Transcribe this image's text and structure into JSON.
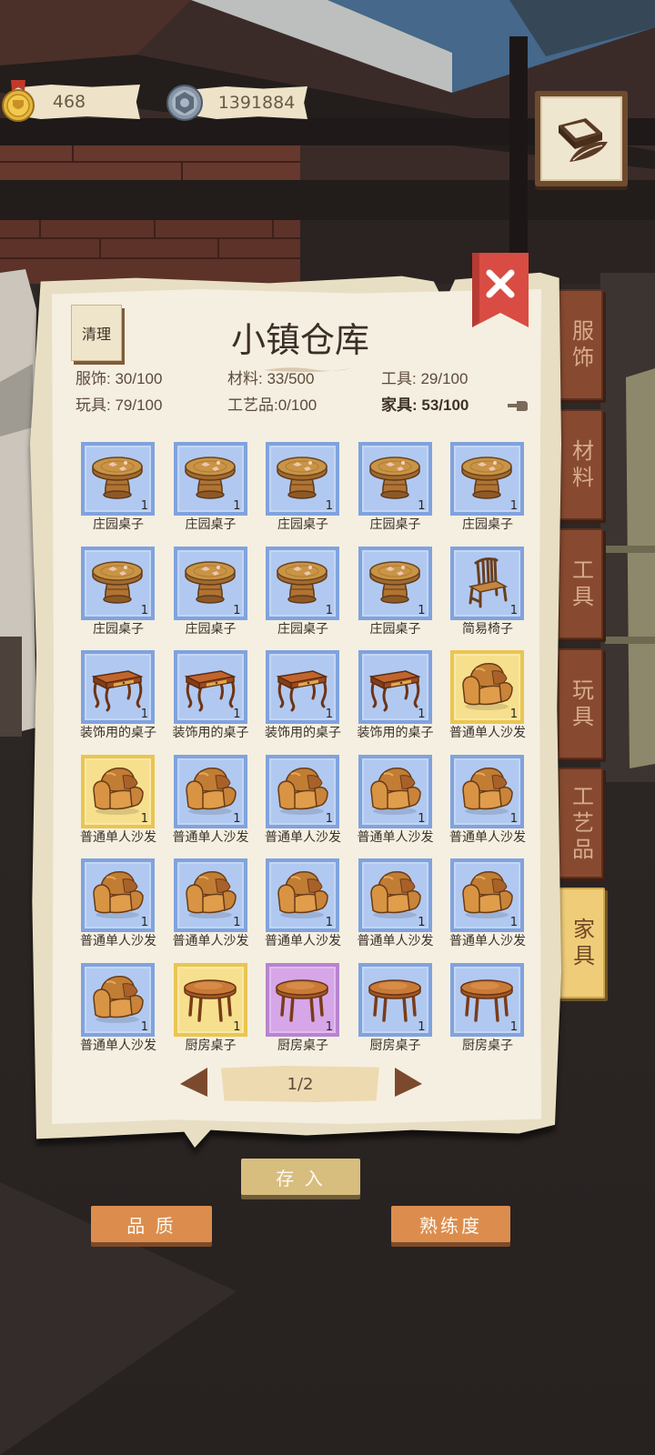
{
  "currency": {
    "gold": {
      "icon": "gold-coin-icon",
      "value": "468"
    },
    "gear": {
      "icon": "gear-coin-icon",
      "value": "1391884"
    }
  },
  "journal": {
    "icon": "journal-icon"
  },
  "warehouse": {
    "title": "小镇仓库",
    "clear_label": "清理",
    "close_icon": "close-icon",
    "stats": [
      {
        "text": "服饰: 30/100",
        "highlight": false
      },
      {
        "text": "材料: 33/500",
        "highlight": false
      },
      {
        "text": "工具: 29/100",
        "highlight": false
      },
      {
        "text": "玩具: 79/100",
        "highlight": false
      },
      {
        "text": "工艺品:0/100",
        "highlight": false
      },
      {
        "text": "家具: 53/100",
        "highlight": true
      }
    ],
    "stats_hint_icon": "pointing-hand-icon"
  },
  "tabs": [
    {
      "label": "服饰",
      "active": false
    },
    {
      "label": "材料",
      "active": false
    },
    {
      "label": "工具",
      "active": false
    },
    {
      "label": "玩具",
      "active": false
    },
    {
      "label": "工艺品",
      "active": false
    },
    {
      "label": "家具",
      "active": true
    }
  ],
  "rarity_colors": {
    "blue": {
      "fill": "#b1c9f1",
      "border": "#80a3de"
    },
    "yellow": {
      "fill": "#f6e08e",
      "border": "#eac550"
    },
    "purple": {
      "fill": "#d6a6e8",
      "border": "#b784ce"
    }
  },
  "items": [
    {
      "name": "庄园桌子",
      "icon": "round-table-icon",
      "rarity": "blue",
      "count": "1"
    },
    {
      "name": "庄园桌子",
      "icon": "round-table-icon",
      "rarity": "blue",
      "count": "1"
    },
    {
      "name": "庄园桌子",
      "icon": "round-table-icon",
      "rarity": "blue",
      "count": "1"
    },
    {
      "name": "庄园桌子",
      "icon": "round-table-icon",
      "rarity": "blue",
      "count": "1"
    },
    {
      "name": "庄园桌子",
      "icon": "round-table-icon",
      "rarity": "blue",
      "count": "1"
    },
    {
      "name": "庄园桌子",
      "icon": "round-table-icon",
      "rarity": "blue",
      "count": "1"
    },
    {
      "name": "庄园桌子",
      "icon": "round-table-icon",
      "rarity": "blue",
      "count": "1"
    },
    {
      "name": "庄园桌子",
      "icon": "round-table-icon",
      "rarity": "blue",
      "count": "1"
    },
    {
      "name": "庄园桌子",
      "icon": "round-table-icon",
      "rarity": "blue",
      "count": "1"
    },
    {
      "name": "简易椅子",
      "icon": "chair-icon",
      "rarity": "blue",
      "count": "1"
    },
    {
      "name": "装饰用的桌子",
      "icon": "desk-icon",
      "rarity": "blue",
      "count": "1"
    },
    {
      "name": "装饰用的桌子",
      "icon": "desk-icon",
      "rarity": "blue",
      "count": "1"
    },
    {
      "name": "装饰用的桌子",
      "icon": "desk-icon",
      "rarity": "blue",
      "count": "1"
    },
    {
      "name": "装饰用的桌子",
      "icon": "desk-icon",
      "rarity": "blue",
      "count": "1"
    },
    {
      "name": "普通单人沙发",
      "icon": "armchair-icon",
      "rarity": "yellow",
      "count": "1"
    },
    {
      "name": "普通单人沙发",
      "icon": "armchair-icon",
      "rarity": "yellow",
      "count": "1"
    },
    {
      "name": "普通单人沙发",
      "icon": "armchair-icon",
      "rarity": "blue",
      "count": "1"
    },
    {
      "name": "普通单人沙发",
      "icon": "armchair-icon",
      "rarity": "blue",
      "count": "1"
    },
    {
      "name": "普通单人沙发",
      "icon": "armchair-icon",
      "rarity": "blue",
      "count": "1"
    },
    {
      "name": "普通单人沙发",
      "icon": "armchair-icon",
      "rarity": "blue",
      "count": "1"
    },
    {
      "name": "普通单人沙发",
      "icon": "armchair-icon",
      "rarity": "blue",
      "count": "1"
    },
    {
      "name": "普通单人沙发",
      "icon": "armchair-icon",
      "rarity": "blue",
      "count": "1"
    },
    {
      "name": "普通单人沙发",
      "icon": "armchair-icon",
      "rarity": "blue",
      "count": "1"
    },
    {
      "name": "普通单人沙发",
      "icon": "armchair-icon",
      "rarity": "blue",
      "count": "1"
    },
    {
      "name": "普通单人沙发",
      "icon": "armchair-icon",
      "rarity": "blue",
      "count": "1"
    },
    {
      "name": "普通单人沙发",
      "icon": "armchair-icon",
      "rarity": "blue",
      "count": "1"
    },
    {
      "name": "厨房桌子",
      "icon": "kitchen-table-icon",
      "rarity": "yellow",
      "count": "1"
    },
    {
      "name": "厨房桌子",
      "icon": "kitchen-table-icon",
      "rarity": "purple",
      "count": "1"
    },
    {
      "name": "厨房桌子",
      "icon": "kitchen-table-icon",
      "rarity": "blue",
      "count": "1"
    },
    {
      "name": "厨房桌子",
      "icon": "kitchen-table-icon",
      "rarity": "blue",
      "count": "1"
    }
  ],
  "pagination": {
    "page": "1/2",
    "prev_icon": "arrow-left-icon",
    "next_icon": "arrow-right-icon"
  },
  "actions": {
    "deposit": "存 入",
    "quality": "品 质",
    "proficiency": "熟练度"
  }
}
